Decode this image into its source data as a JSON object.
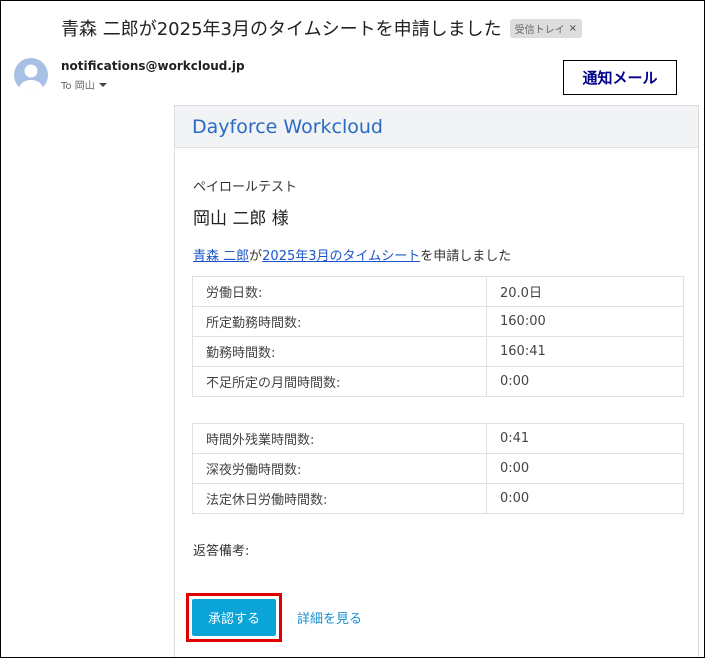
{
  "email": {
    "subject": "青森 二郎が2025年3月のタイムシートを申請しました",
    "label_chip": "受信トレイ",
    "label_close": "×",
    "sender": "notifications@workcloud.jp",
    "to_line": "To 岡山"
  },
  "annotation": {
    "notice_label": "通知メール"
  },
  "card": {
    "brand": "Dayforce Workcloud",
    "company": "ペイロールテスト",
    "recipient": "岡山 二郎 様",
    "message": {
      "applicant": "青森 二郎",
      "particle": "が",
      "timesheet_link": "2025年3月のタイムシート",
      "suffix": "を申請しました"
    },
    "table1": [
      {
        "label": "労働日数:",
        "value": "20.0日"
      },
      {
        "label": "所定勤務時間数:",
        "value": "160:00"
      },
      {
        "label": "勤務時間数:",
        "value": "160:41"
      },
      {
        "label": "不足所定の月間時間数:",
        "value": "0:00"
      }
    ],
    "table2": [
      {
        "label": "時間外残業時間数:",
        "value": "0:41"
      },
      {
        "label": "深夜労働時間数:",
        "value": "0:00"
      },
      {
        "label": "法定休日労働時間数:",
        "value": "0:00"
      }
    ],
    "remarks_label": "返答備考:",
    "approve_label": "承認する",
    "detail_link": "詳細を見る"
  },
  "colors": {
    "brand": "#2a6ac6",
    "approve_button": "#0ba4d9",
    "highlight_outline": "#e00000",
    "notice_text": "#00008b"
  }
}
